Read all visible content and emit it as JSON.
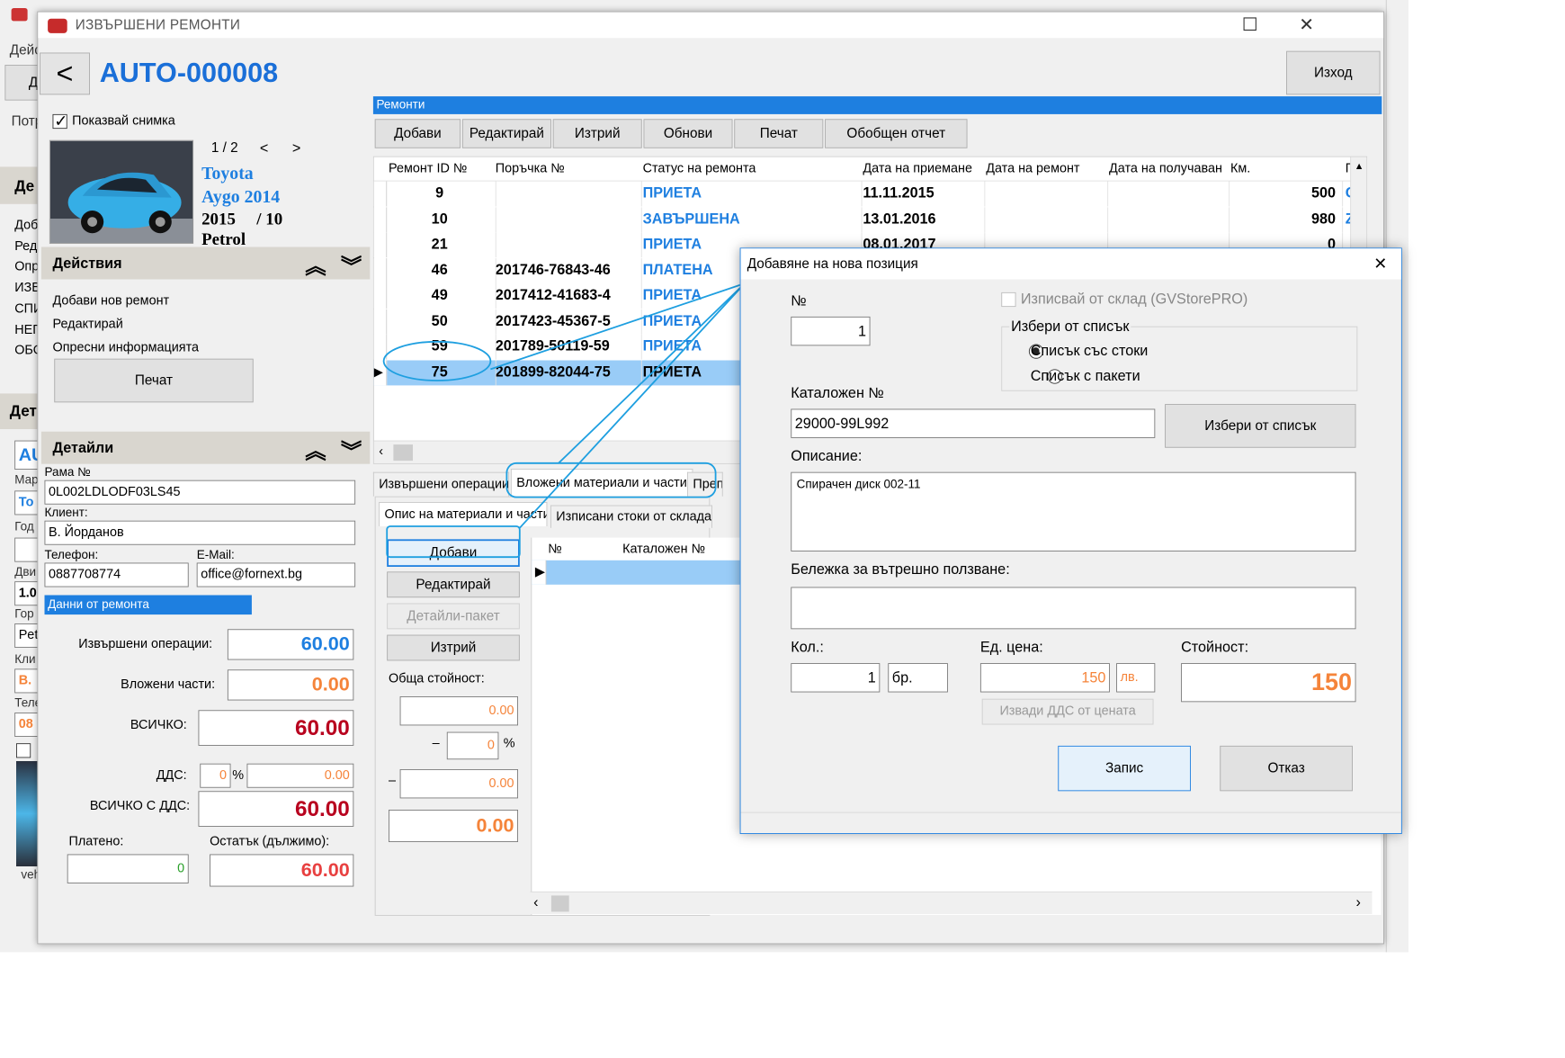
{
  "bg_app": {
    "menu_partial": "Дейс",
    "btn_partial": "Д",
    "label_partial": "Потр",
    "side_header": "Де",
    "side_items": [
      "Доб",
      "Ред",
      "Опр",
      "ИЗВ",
      "СПИ",
      "НЕП",
      "ОБО"
    ],
    "details_header": "Дет",
    "field_labels": [
      "Мар",
      "Год",
      "Дви",
      "Гор",
      "Кли",
      "Теле"
    ],
    "field_values": [
      "AU",
      "То",
      "1.0",
      "Pet",
      "В.",
      "08"
    ],
    "footer_text": "veh"
  },
  "window": {
    "title": "ИЗВЪРШЕНИ РЕМОНТИ",
    "car_id": "AUTO-000008",
    "back_label": "<",
    "exit_label": "Изход",
    "minimize": "—",
    "maximize": "☐",
    "close": "✕"
  },
  "car": {
    "show_photo_label": "Показвай снимка",
    "photo_counter": "1 / 2",
    "prev": "<",
    "next": ">",
    "make": "Toyota",
    "model": "Aygo 2014",
    "year": "2015",
    "month": "/ 10",
    "fuel": "Petrol"
  },
  "actions": {
    "header": "Действия",
    "items": [
      "Добави нов ремонт",
      "Редактирай",
      "Опресни информацията"
    ],
    "print_label": "Печат"
  },
  "details": {
    "header": "Детайли",
    "frame_label": "Рама №",
    "frame_value": "0L002LDLODF03LS45",
    "client_label": "Клиент:",
    "client_value": "В. Йорданов",
    "phone_label": "Телефон:",
    "phone_value": "0887708774",
    "email_label": "E-Mail:",
    "email_value": "office@fornext.bg",
    "repair_data_label": "Данни от ремонта",
    "operations_label": "Извършени операции:",
    "operations_value": "60.00",
    "parts_label": "Вложени части:",
    "parts_value": "0.00",
    "total_label": "ВСИЧКО:",
    "total_value": "60.00",
    "vat_label": "ДДС:",
    "vat_percent": "0",
    "percent_sign": "%",
    "vat_value": "0.00",
    "total_vat_label": "ВСИЧКО С ДДС:",
    "total_vat_value": "60.00",
    "paid_label": "Платено:",
    "paid_value": "0",
    "remaining_label": "Остатък (дължимо):",
    "remaining_value": "60.00"
  },
  "repairs": {
    "header": "Ремонти",
    "toolbar": [
      "Добави",
      "Редактирай",
      "Изтрий",
      "Обнови",
      "Печат",
      "Обобщен отчет"
    ],
    "columns": [
      "Ремонт ID №",
      "Поръчка №",
      "Статус на ремонта",
      "Дата на приемане",
      "Дата на ремонт",
      "Дата на получаван",
      "Км.",
      "По"
    ],
    "rows": [
      {
        "id": "9",
        "order": "",
        "status": "ПРИЕТА",
        "date": "11.11.2015",
        "km": "500",
        "extra": "Cl"
      },
      {
        "id": "10",
        "order": "",
        "status": "ЗАВЪРШЕНА",
        "date": "13.01.2016",
        "km": "980",
        "extra": "ZI"
      },
      {
        "id": "21",
        "order": "",
        "status": "ПРИЕТА",
        "date": "08.01.2017",
        "km": "0",
        "extra": ""
      },
      {
        "id": "46",
        "order": "201746-76843-46",
        "status": "ПЛАТЕНА",
        "date": "",
        "km": "",
        "extra": ""
      },
      {
        "id": "49",
        "order": "2017412-41683-4",
        "status": "ПРИЕТА",
        "date": "",
        "km": "",
        "extra": ""
      },
      {
        "id": "50",
        "order": "2017423-45367-5",
        "status": "ПРИЕТА",
        "date": "",
        "km": "",
        "extra": ""
      },
      {
        "id": "59",
        "order": "201789-50119-59",
        "status": "ПРИЕТА",
        "date": "",
        "km": "",
        "extra": ""
      },
      {
        "id": "75",
        "order": "201899-82044-75",
        "status": "ПРИЕТА",
        "date": "",
        "km": "",
        "extra": ""
      }
    ]
  },
  "bottom_tabs": {
    "tabs": [
      "Извършени операции",
      "Вложени материали и части",
      "Преп"
    ],
    "subtabs": [
      "Опис на материали и части",
      "Изписани стоки от склада (GV"
    ],
    "buttons": [
      "Добави",
      "Редактирай",
      "Детайли-пакет",
      "Изтрий"
    ],
    "total_label": "Обща стойност:",
    "total_value": "0.00",
    "discount_minus": "–",
    "discount_percent": "0",
    "percent_sign": "%",
    "discount_value": "0.00",
    "final_value": "0.00",
    "grid_columns": [
      "№",
      "Каталожен №"
    ]
  },
  "dialog": {
    "title": "Добавяне на нова позиция",
    "close": "✕",
    "no_label": "№",
    "no_value": "1",
    "store_checkbox": "Изписвай от склад (GVStorePRO)",
    "choose_group": "Избери от списък",
    "radio_goods": "Списък със стоки",
    "radio_packages": "Списък с пакети",
    "catalog_label": "Каталожен №",
    "catalog_value": "29000-99L992",
    "choose_button": "Избери от списък",
    "description_label": "Описание:",
    "description_value": "Спирачен диск 002-11",
    "note_label": "Бележка за вътрешно ползване:",
    "note_value": "",
    "qty_label": "Кол.:",
    "qty_value": "1",
    "unit_value": "бр.",
    "price_label": "Ед. цена:",
    "price_value": "150",
    "currency": "лв.",
    "value_label": "Стойност:",
    "value_value": "150",
    "vat_button": "Извади ДДС от цената",
    "save_button": "Запис",
    "cancel_button": "Отказ"
  }
}
